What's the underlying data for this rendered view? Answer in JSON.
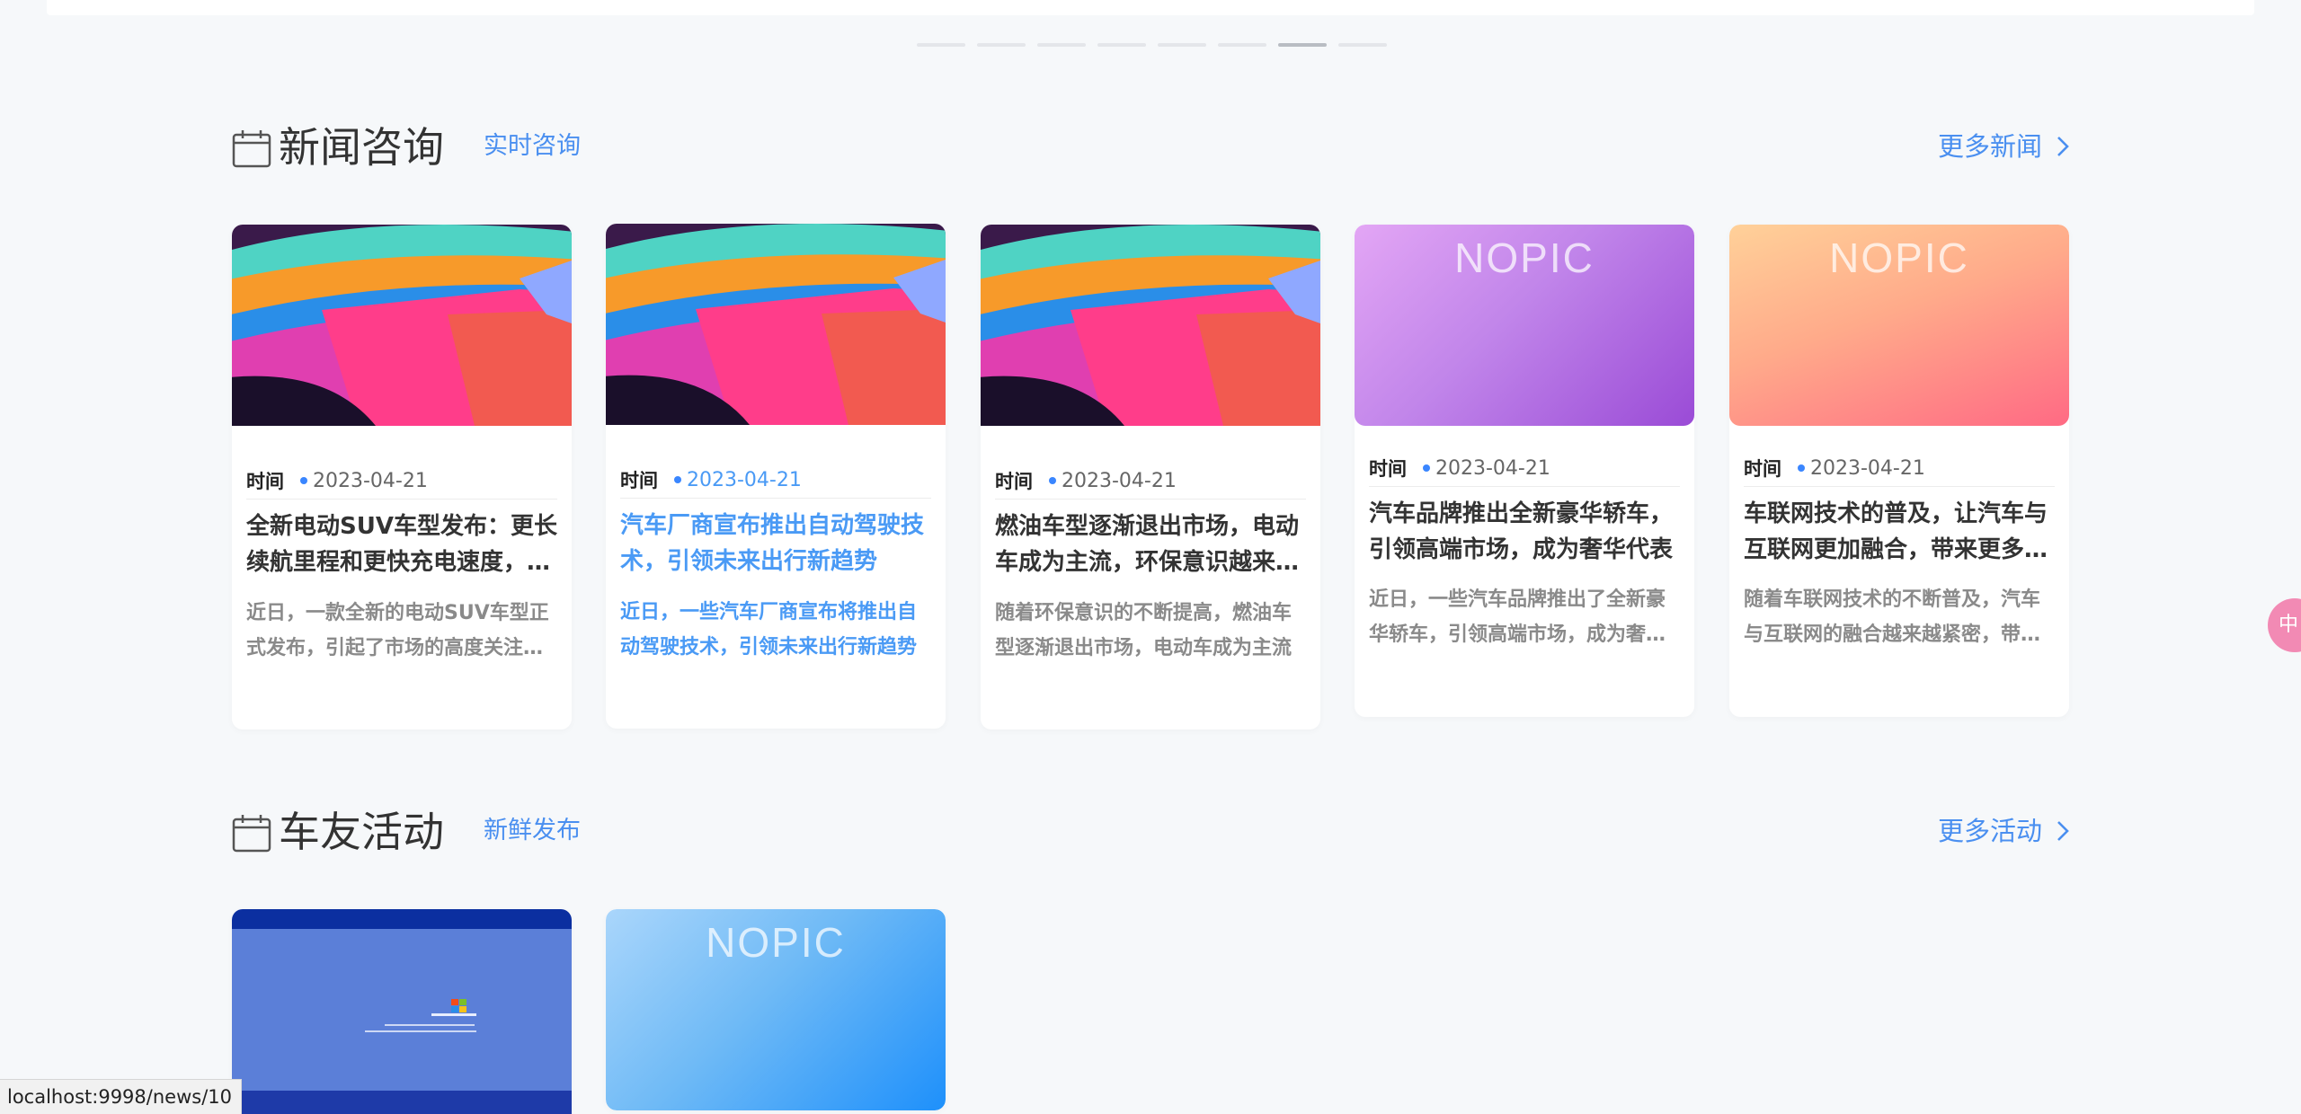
{
  "carousel": {
    "active_index": 6,
    "count": 8
  },
  "news_section": {
    "title": "新闻咨询",
    "subtitle": "实时咨询",
    "more_label": "更多新闻",
    "cards": [
      {
        "thumb": "abstract-colorful",
        "time_label": "时间",
        "date": "2023-04-21",
        "headline": "全新电动SUV车型发布：更长续航里程和更快充电速度，引领新能源汽车发展",
        "summary": "近日，一款全新的电动SUV车型正式发布，引起了市场的高度关注和热议"
      },
      {
        "thumb": "abstract-colorful",
        "time_label": "时间",
        "date": "2023-04-21",
        "headline": "汽车厂商宣布推出自动驾驶技术，引领未来出行新趋势",
        "summary": "近日，一些汽车厂商宣布将推出自动驾驶技术，引领未来出行新趋势"
      },
      {
        "thumb": "abstract-colorful",
        "time_label": "时间",
        "date": "2023-04-21",
        "headline": "燃油车型逐渐退出市场，电动车成为主流，环保意识越来越强",
        "summary": "随着环保意识的不断提高，燃油车型逐渐退出市场，电动车成为主流"
      },
      {
        "thumb": "NOPIC",
        "time_label": "时间",
        "date": "2023-04-21",
        "headline": "汽车品牌推出全新豪华轿车，引领高端市场，成为奢华代表",
        "summary": "近日，一些汽车品牌推出了全新豪华轿车，引领高端市场，成为奢华代表"
      },
      {
        "thumb": "NOPIC",
        "time_label": "时间",
        "date": "2023-04-21",
        "headline": "车联网技术的普及，让汽车与互联网更加融合，带来更多便利",
        "summary": "随着车联网技术的不断普及，汽车与互联网的融合越来越紧密，带来更多便利"
      }
    ]
  },
  "activity_section": {
    "title": "车友活动",
    "subtitle": "新鲜发布",
    "more_label": "更多活动",
    "cards": [
      {
        "thumb": "windows-screen"
      },
      {
        "thumb": "NOPIC"
      }
    ]
  },
  "floating_button": {
    "label": "中"
  },
  "status_bar": {
    "url": "localhost:9998/news/10"
  },
  "colors": {
    "accent": "#4a8ff0",
    "background": "#f6f8fa",
    "card": "#ffffff"
  }
}
